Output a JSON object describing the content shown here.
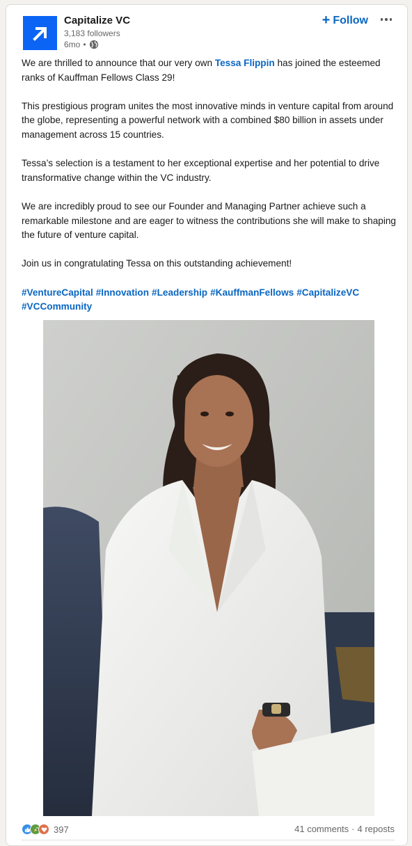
{
  "post": {
    "author": {
      "name": "Capitalize VC",
      "followers": "3,183 followers",
      "time": "6mo",
      "separator": "•"
    },
    "follow_label": "Follow",
    "follow_plus": "+",
    "paragraphs": {
      "p1_before": "We are thrilled to announce that our very own ",
      "p1_mention": "Tessa Flippin",
      "p1_after": " has joined the esteemed ranks of Kauffman Fellows Class 29!",
      "p2": "This prestigious program unites the most innovative minds in venture capital from around the globe, representing a powerful network with a combined $80 billion in assets under management across 15 countries.",
      "p3": "Tessa’s selection is a testament to her exceptional expertise and her potential to drive transformative change within the VC industry.",
      "p4": "We are incredibly proud to see our Founder and Managing Partner achieve such a remarkable milestone and are eager to witness the contributions she will make to shaping the future of venture capital.",
      "p5": "Join us in congratulating Tessa on this outstanding achievement!"
    },
    "hashtags": [
      "#VentureCapital",
      "#Innovation",
      "#Leadership",
      "#KauffmanFellows",
      "#CapitalizeVC",
      "#VCCommunity"
    ],
    "reactions": {
      "icons": [
        "like-icon",
        "celebrate-icon",
        "love-icon"
      ],
      "count": "397"
    },
    "comments": "41 comments",
    "stats_separator": "·",
    "reposts": "4 reposts"
  },
  "colors": {
    "accent": "#0a66c2",
    "logo_bg": "#0b64f4",
    "like": "#378fe9",
    "celebrate": "#5f9b41",
    "love": "#df704d"
  }
}
